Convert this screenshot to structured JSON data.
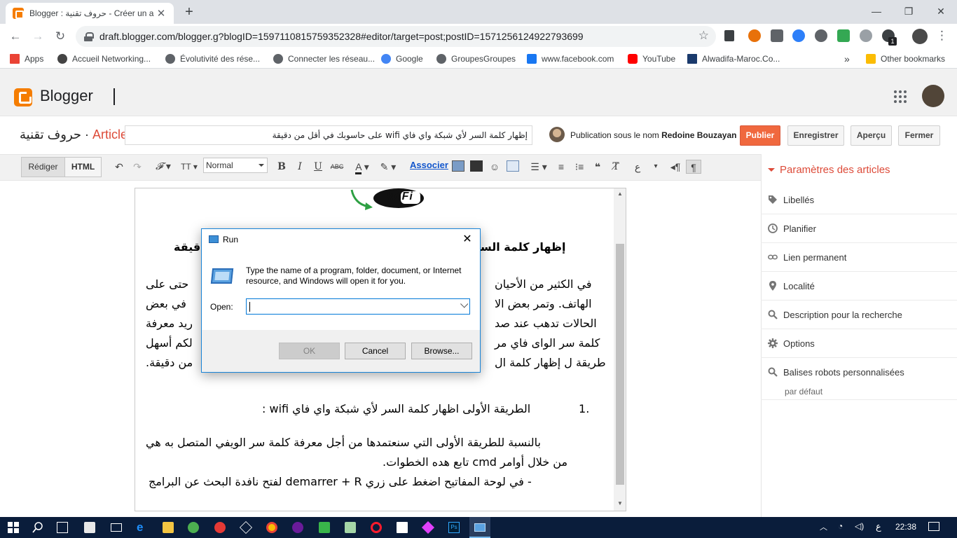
{
  "browser": {
    "tab_title": "Blogger : حروف تقنية - Créer un a",
    "url": "draft.blogger.com/blogger.g?blogID=1597110815759352328#editor/target=post;postID=1571256124922793699",
    "extension_badge": "1",
    "bookmarks": [
      {
        "label": "Apps",
        "color": "#ea4335"
      },
      {
        "label": "Accueil Networking...",
        "color": "#444444"
      },
      {
        "label": "Évolutivité des rése...",
        "color": "#5f6368"
      },
      {
        "label": "Connecter les réseau...",
        "color": "#5f6368"
      },
      {
        "label": "Google",
        "color": "#4285f4"
      },
      {
        "label": "GroupesGroupes",
        "color": "#5f6368"
      },
      {
        "label": "www.facebook.com",
        "color": "#1877f2"
      },
      {
        "label": "YouTube",
        "color": "#ff0000"
      },
      {
        "label": "Alwadifa-Maroc.Co...",
        "color": "#1a3a6c"
      }
    ],
    "bookmarks_overflow": "»",
    "other_bookmarks": "Other bookmarks"
  },
  "blogger": {
    "app_name": "Blogger",
    "blog_name": "حروف تقنية",
    "separator": " · ",
    "section": "Article",
    "post_title": "إظهار كلمة السر لأي شبكة واي فاي wifi على حاسوبك في أقل من دقيقة",
    "publish_as_prefix": "Publication sous le nom",
    "author": "Redoine Bouzayan",
    "buttons": {
      "publish": "Publier",
      "save": "Enregistrer",
      "preview": "Aperçu",
      "close": "Fermer"
    }
  },
  "editor": {
    "mode_compose": "Rédiger",
    "mode_html": "HTML",
    "format_value": "Normal",
    "link_label": "Associer",
    "image_text": "WiFi",
    "heading": "إظهار كلمة السر",
    "heading_end": "دقيقة",
    "para1_lines": [
      "في الكثير من الأحيان",
      "الهاتف. وتمر بعض الا",
      "الحالات تدهب عند صد",
      "كلمة سر الواى فاي مر",
      "طريقة ل إظهار كلمة ال"
    ],
    "para1_right_lines": [
      "حتى على",
      "في بعض",
      "ريد معرفة",
      "لكم أسهل",
      "من دقيقة."
    ],
    "list_item": "الطريقة الأولى اظهار كلمة السر لأي شبكة واي فاي wifi :",
    "list_number": ".1",
    "para2_lines": [
      "بالنسبة للطريقة الأولى التي سنعتمدها من أجل معرفة كلمة سر الويفي المتصل به هي",
      "من خلال أوامر cmd تابع هده الخطوات.",
      "- في لوحة المفاتيح اضغط على زري demarrer + R لفتح نافدة البحث عن البرامج"
    ]
  },
  "sidebar": {
    "title": "Paramètres des articles",
    "items": [
      {
        "label": "Libellés",
        "icon": "tag-icon"
      },
      {
        "label": "Planifier",
        "icon": "clock-icon"
      },
      {
        "label": "Lien permanent",
        "icon": "link-icon"
      },
      {
        "label": "Localité",
        "icon": "location-icon"
      },
      {
        "label": "Description pour la recherche",
        "icon": "search-icon"
      },
      {
        "label": "Options",
        "icon": "gear-icon"
      },
      {
        "label": "Balises robots personnalisées",
        "icon": "search-icon"
      }
    ],
    "robots_default": "par défaut"
  },
  "run_dialog": {
    "title": "Run",
    "message": "Type the name of a program, folder, document, or Internet resource, and Windows will open it for you.",
    "open_label": "Open:",
    "input_value": "",
    "ok": "OK",
    "cancel": "Cancel",
    "browse": "Browse..."
  },
  "taskbar": {
    "lang": "ع",
    "time": "22:38"
  },
  "colors": {
    "blogger_orange": "#f57d00",
    "publish": "#f0683e",
    "accent_red": "#dd4b39",
    "taskbar": "#0a1d3b",
    "dialog_border": "#1883d7"
  }
}
